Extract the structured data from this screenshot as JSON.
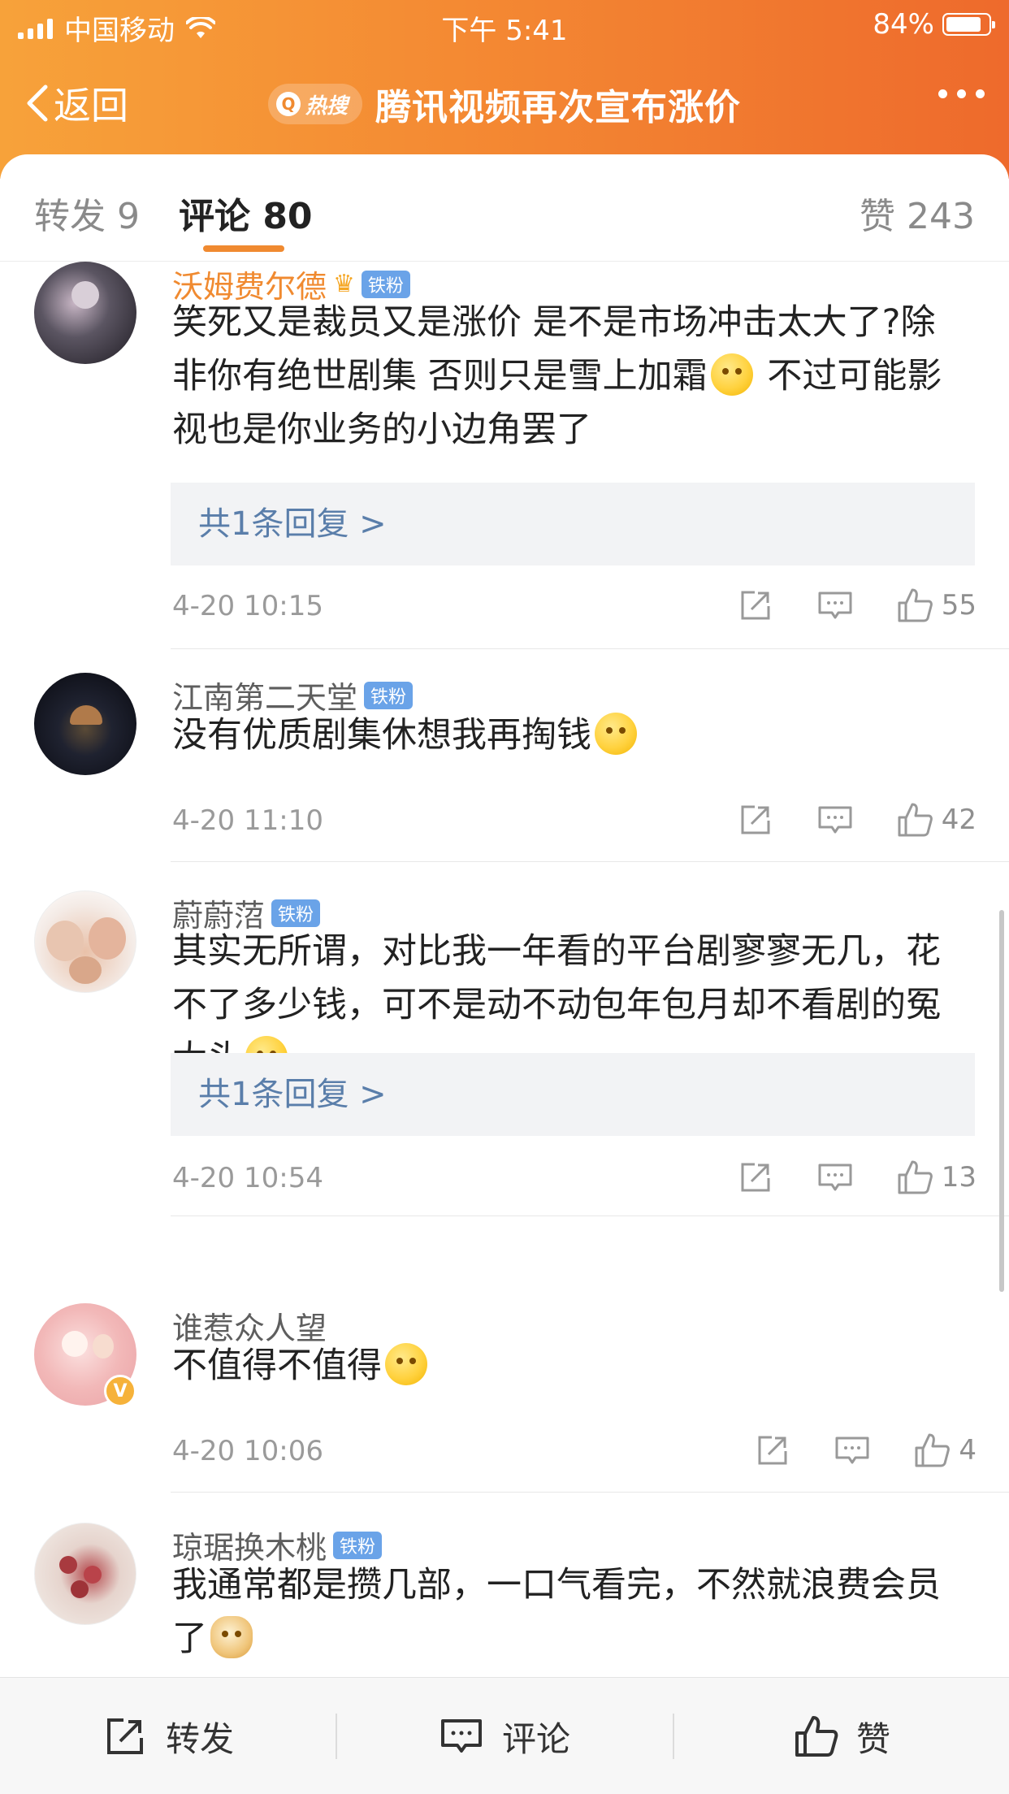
{
  "status_bar": {
    "carrier": "中国移动",
    "time": "下午 5:41",
    "battery": "84%",
    "battery_level": 0.84
  },
  "nav": {
    "back_label": "返回",
    "hot_badge": "热搜",
    "title": "腾讯视频再次宣布涨价"
  },
  "tabs": [
    {
      "label": "转发 9"
    },
    {
      "label": "评论 80",
      "active": true
    },
    {
      "label": "赞 243"
    }
  ],
  "comments": [
    {
      "user": "沃姆费尔德",
      "badge": "铁粉",
      "vip": true,
      "text_parts": [
        "笑死又是裁员又是涨价 是不是市场冲击太大了?除非你有绝世剧集 否则只是雪上加霜",
        " 不过可能影视也是你业务的小边角罢了"
      ],
      "reply": "共1条回复 >",
      "time": "4-20 10:15",
      "likes": "55"
    },
    {
      "user": "江南第二天堂",
      "badge": "铁粉",
      "text_parts": [
        "没有优质剧集休想我再掏钱",
        ""
      ],
      "time": "4-20 11:10",
      "likes": "42"
    },
    {
      "user": "蔚蔚菬",
      "badge": "铁粉",
      "text_parts": [
        "其实无所谓，对比我一年看的平台剧寥寥无几，花不了多少钱，可不是动不动包年包月却不看剧的冤大头",
        ""
      ],
      "reply": "共1条回复 >",
      "time": "4-20 10:54",
      "likes": "13"
    },
    {
      "user": "谁惹众人望",
      "text_parts": [
        "不值得不值得",
        ""
      ],
      "time": "4-20 10:06",
      "likes": "4"
    },
    {
      "user": "琼琚换木桃",
      "badge": "铁粉",
      "text_parts": [
        "我通常都是攒几部，一口气看完，不然就浪费会员了",
        ""
      ]
    }
  ],
  "bottom_bar": {
    "repost": "转发",
    "comment": "评论",
    "like": "赞"
  },
  "colors": {
    "accent": "#f08a30",
    "badge_blue": "#6aa3e8",
    "link_blue": "#5a7eaa"
  }
}
